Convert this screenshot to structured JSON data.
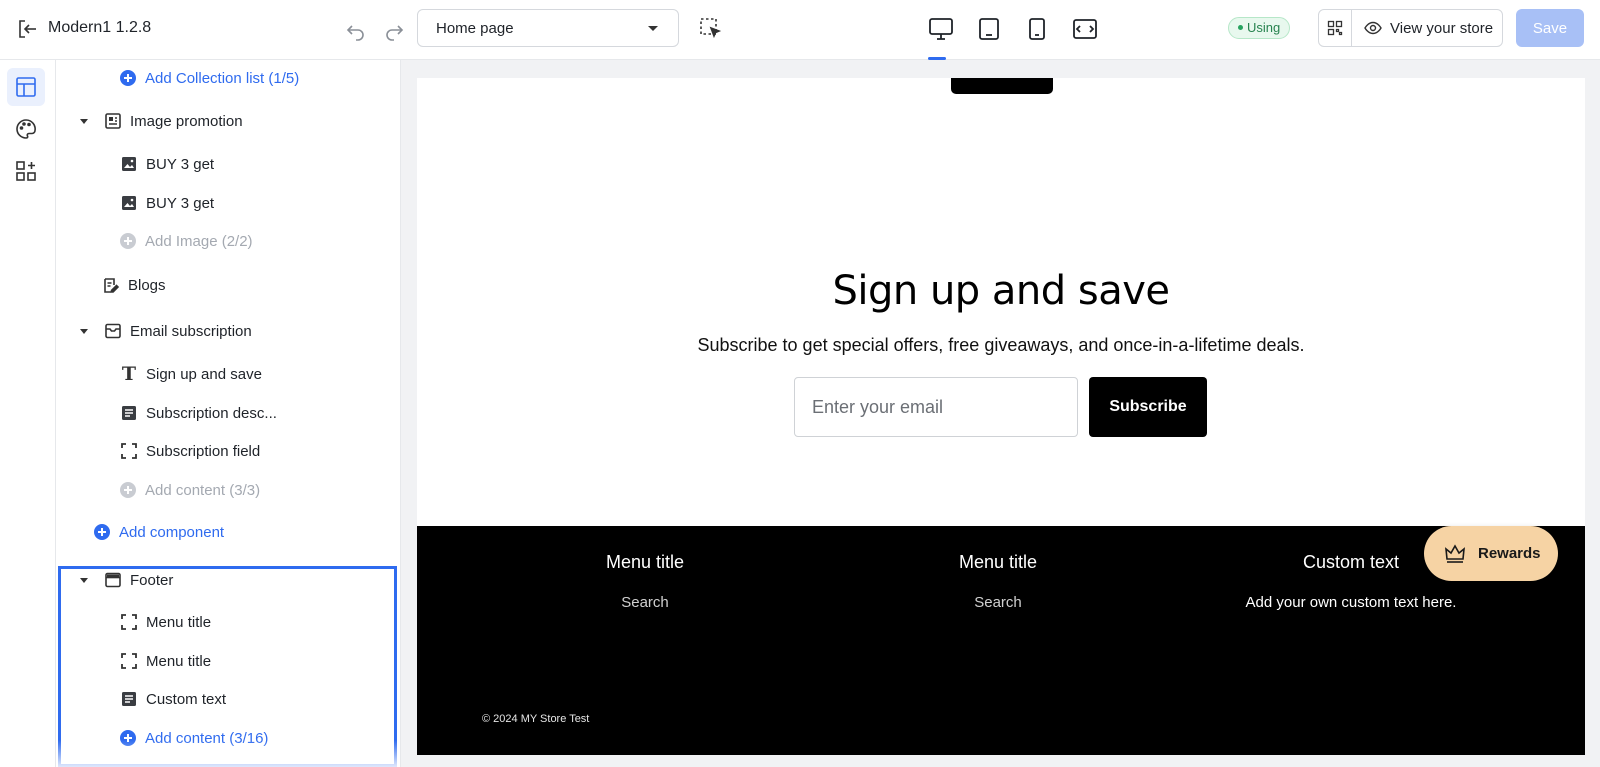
{
  "topbar": {
    "title": "Modern1 1.2.8",
    "page_select": {
      "value": "Home page"
    },
    "status_badge": "Using",
    "view_store_label": "View your store",
    "save_label": "Save"
  },
  "sidebar": {
    "add_collection": "Add Collection list (1/5)",
    "image_promotion": {
      "label": "Image promotion",
      "items": [
        "BUY 3 get",
        "BUY 3 get"
      ],
      "add": "Add Image (2/2)"
    },
    "blogs": "Blogs",
    "email_subscription": {
      "label": "Email subscription",
      "items": [
        "Sign up and save",
        "Subscription desc...",
        "Subscription field"
      ],
      "add": "Add content (3/3)"
    },
    "add_component": "Add component",
    "footer": {
      "label": "Footer",
      "items": [
        "Menu title",
        "Menu title",
        "Custom text"
      ],
      "add": "Add content (3/16)"
    }
  },
  "preview": {
    "signup": {
      "title": "Sign up and save",
      "description": "Subscribe to get special offers, free giveaways, and once-in-a-lifetime deals.",
      "email_placeholder": "Enter your email",
      "subscribe_label": "Subscribe"
    },
    "footer": {
      "columns": [
        {
          "title": "Menu title",
          "link": "Search"
        },
        {
          "title": "Menu title",
          "link": "Search"
        },
        {
          "title": "Custom text",
          "text": "Add your own custom text here."
        }
      ],
      "copyright": "© 2024 MY Store Test"
    },
    "rewards_label": "Rewards"
  },
  "colors": {
    "accent": "#2f6bef",
    "save_disabled": "#a8c0f6",
    "rewards_bg": "#f6d3a4",
    "badge_green": "#27834f"
  }
}
